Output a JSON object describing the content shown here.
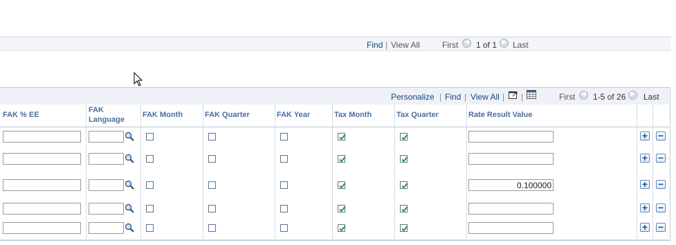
{
  "top_nav": {
    "find": "Find",
    "view_all": "View All",
    "first": "First",
    "count": "1 of 1",
    "last": "Last"
  },
  "grid_nav": {
    "personalize": "Personalize",
    "find": "Find",
    "view_all": "View All",
    "first": "First",
    "count": "1-5 of 26",
    "last": "Last"
  },
  "columns": {
    "fak_pct_ee": "FAK % EE",
    "fak_language_1": "FAK",
    "fak_language_2": "Language",
    "fak_month": "FAK Month",
    "fak_quarter": "FAK Quarter",
    "fak_year": "FAK Year",
    "tax_month": "Tax Month",
    "tax_quarter": "Tax Quarter",
    "rate_result_value": "Rate Result Value"
  },
  "rows": [
    {
      "fak_pct_ee": "",
      "fak_language": "",
      "fak_month": false,
      "fak_quarter": false,
      "fak_year": false,
      "tax_month": true,
      "tax_quarter": true,
      "rate_result_value": ""
    },
    {
      "fak_pct_ee": "",
      "fak_language": "",
      "fak_month": false,
      "fak_quarter": false,
      "fak_year": false,
      "tax_month": true,
      "tax_quarter": true,
      "rate_result_value": ""
    },
    {
      "fak_pct_ee": "",
      "fak_language": "",
      "fak_month": false,
      "fak_quarter": false,
      "fak_year": false,
      "tax_month": true,
      "tax_quarter": true,
      "rate_result_value": "0.100000"
    },
    {
      "fak_pct_ee": "",
      "fak_language": "",
      "fak_month": false,
      "fak_quarter": false,
      "fak_year": false,
      "tax_month": true,
      "tax_quarter": true,
      "rate_result_value": ""
    },
    {
      "fak_pct_ee": "",
      "fak_language": "",
      "fak_month": false,
      "fak_quarter": false,
      "fak_year": false,
      "tax_month": true,
      "tax_quarter": true,
      "rate_result_value": ""
    }
  ],
  "icons": {
    "lookup": "magnifier-icon",
    "zoom": "zoom-grid-icon",
    "download": "spreadsheet-icon",
    "add": "plus-icon",
    "delete": "minus-icon",
    "first": "arrow-left-icon",
    "last": "arrow-right-icon",
    "cursor": "mouse-pointer-icon"
  },
  "colors": {
    "link": "#14457c",
    "header_text": "#4a6f9c",
    "check": "#2c8a2c"
  }
}
